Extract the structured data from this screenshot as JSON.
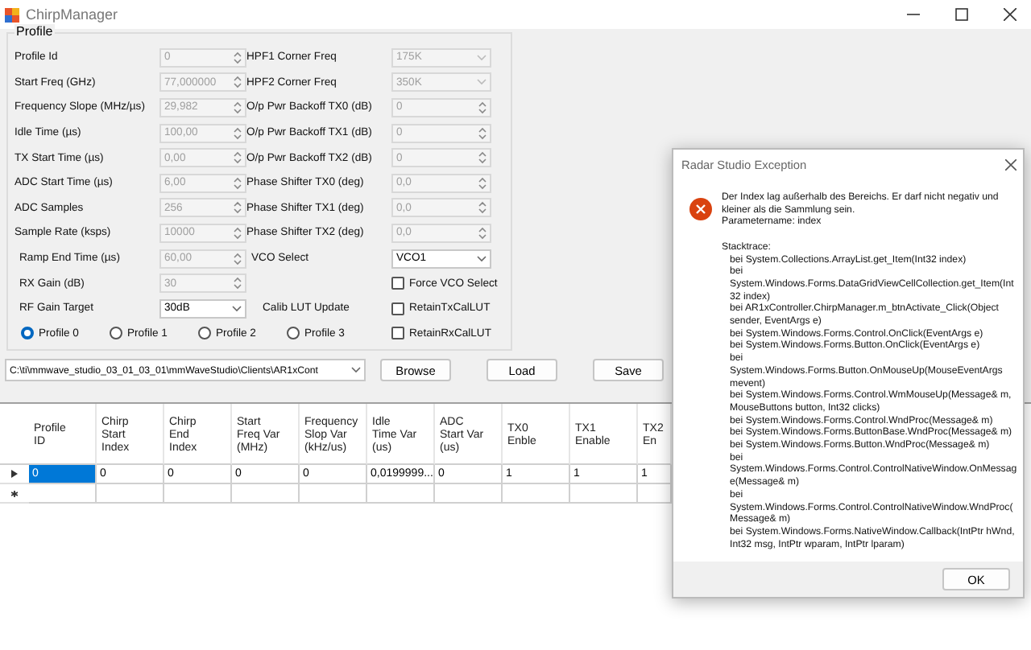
{
  "window": {
    "title": "ChirpManager"
  },
  "profile": {
    "title": "Profile",
    "left_fields": [
      {
        "label": "Profile Id",
        "value": "0",
        "kind": "spin",
        "disabled": true
      },
      {
        "label": "Start Freq (GHz)",
        "value": "77,000000",
        "kind": "spin",
        "disabled": true
      },
      {
        "label": "Frequency Slope (MHz/µs)",
        "value": "29,982",
        "kind": "spin",
        "disabled": true
      },
      {
        "label": "Idle Time (µs)",
        "value": "100,00",
        "kind": "spin",
        "disabled": true
      },
      {
        "label": "TX Start Time (µs)",
        "value": "0,00",
        "kind": "spin",
        "disabled": true
      },
      {
        "label": "ADC Start Time (µs)",
        "value": "6,00",
        "kind": "spin",
        "disabled": true
      },
      {
        "label": "ADC Samples",
        "value": "256",
        "kind": "spin",
        "disabled": true
      },
      {
        "label": "Sample Rate (ksps)",
        "value": "10000",
        "kind": "spin",
        "disabled": true
      },
      {
        "label": "Ramp End Time (µs)",
        "value": "60,00",
        "kind": "spin",
        "disabled": true
      },
      {
        "label": "RX Gain (dB)",
        "value": "30",
        "kind": "spin",
        "disabled": true
      },
      {
        "label": "RF Gain Target",
        "value": "30dB",
        "kind": "combo",
        "disabled": false
      }
    ],
    "right_fields": [
      {
        "label": "HPF1 Corner Freq",
        "value": "175K",
        "kind": "combo",
        "disabled": true
      },
      {
        "label": "HPF2 Corner Freq",
        "value": "350K",
        "kind": "combo",
        "disabled": true
      },
      {
        "label": "O/p Pwr Backoff TX0 (dB)",
        "value": "0",
        "kind": "spin",
        "disabled": true
      },
      {
        "label": "O/p Pwr Backoff TX1 (dB)",
        "value": "0",
        "kind": "spin",
        "disabled": true
      },
      {
        "label": "O/p Pwr Backoff TX2 (dB)",
        "value": "0",
        "kind": "spin",
        "disabled": true
      },
      {
        "label": "Phase Shifter TX0 (deg)",
        "value": "0,0",
        "kind": "spin",
        "disabled": true
      },
      {
        "label": "Phase Shifter TX1 (deg)",
        "value": "0,0",
        "kind": "spin",
        "disabled": true
      },
      {
        "label": "Phase Shifter TX2 (deg)",
        "value": "0,0",
        "kind": "spin",
        "disabled": true
      },
      {
        "label": "VCO Select",
        "value": "VCO1",
        "kind": "combo",
        "disabled": false
      },
      {
        "label": "Force VCO Select",
        "kind": "checkbox",
        "checked": false
      },
      {
        "caption": "Calib LUT Update",
        "label": "RetainTxCalLUT",
        "kind": "checkbox",
        "checked": false
      },
      {
        "label": "RetainRxCalLUT",
        "kind": "checkbox",
        "checked": false
      }
    ],
    "profiles": [
      {
        "label": "Profile 0",
        "selected": true
      },
      {
        "label": "Profile 1",
        "selected": false
      },
      {
        "label": "Profile 2",
        "selected": false
      },
      {
        "label": "Profile 3",
        "selected": false
      }
    ]
  },
  "path": {
    "value": "C:\\ti\\mmwave_studio_03_01_03_01\\mmWaveStudio\\Clients\\AR1xCont"
  },
  "buttons": [
    "Browse",
    "Load",
    "Save"
  ],
  "table": {
    "columns": [
      "Profile\nID",
      "Chirp\nStart\nIndex",
      "Chirp\nEnd\nIndex",
      "Start\nFreq Var\n(MHz)",
      "Frequency\nSlop Var\n(kHz/us)",
      "Idle\nTime Var\n(us)",
      "ADC\nStart Var\n(us)",
      "TX0\nEnble",
      "TX1\nEnable",
      "TX2\nEn"
    ],
    "rows": [
      {
        "current": true,
        "cells": [
          {
            "value": "0",
            "selected": true
          },
          {
            "value": "0",
            "selected": false
          },
          {
            "value": "0",
            "selected": false
          },
          {
            "value": "0",
            "selected": false
          },
          {
            "value": "0",
            "selected": false
          },
          {
            "value": "0,0199999...",
            "selected": false
          },
          {
            "value": "0",
            "selected": false
          },
          {
            "value": "1",
            "selected": false
          },
          {
            "value": "1",
            "selected": false
          },
          {
            "value": "1",
            "selected": false
          }
        ]
      }
    ],
    "new_row": true
  },
  "dialog": {
    "title": "Radar Studio Exception",
    "message": "Der Index lag außerhalb des Bereichs. Er darf nicht negativ und kleiner als die Sammlung sein.\nParametername: index",
    "stacktrace_label": "Stacktrace:",
    "frames": [
      "bei System.Collections.ArrayList.get_Item(Int32 index)",
      "bei System.Windows.Forms.DataGridViewCellCollection.get_Item(Int32 index)",
      "bei AR1xController.ChirpManager.m_btnActivate_Click(Object sender, EventArgs e)",
      "bei System.Windows.Forms.Control.OnClick(EventArgs e)",
      "bei System.Windows.Forms.Button.OnClick(EventArgs e)",
      "bei System.Windows.Forms.Button.OnMouseUp(MouseEventArgs mevent)",
      "bei System.Windows.Forms.Control.WmMouseUp(Message& m, MouseButtons button, Int32 clicks)",
      "bei System.Windows.Forms.Control.WndProc(Message& m)",
      "bei System.Windows.Forms.ButtonBase.WndProc(Message& m)",
      "bei System.Windows.Forms.Button.WndProc(Message& m)",
      "bei System.Windows.Forms.Control.ControlNativeWindow.OnMessage(Message& m)",
      "bei System.Windows.Forms.Control.ControlNativeWindow.WndProc(Message& m)",
      "bei System.Windows.Forms.NativeWindow.Callback(IntPtr hWnd, Int32 msg, IntPtr wparam, IntPtr lparam)"
    ],
    "button": "OK"
  }
}
